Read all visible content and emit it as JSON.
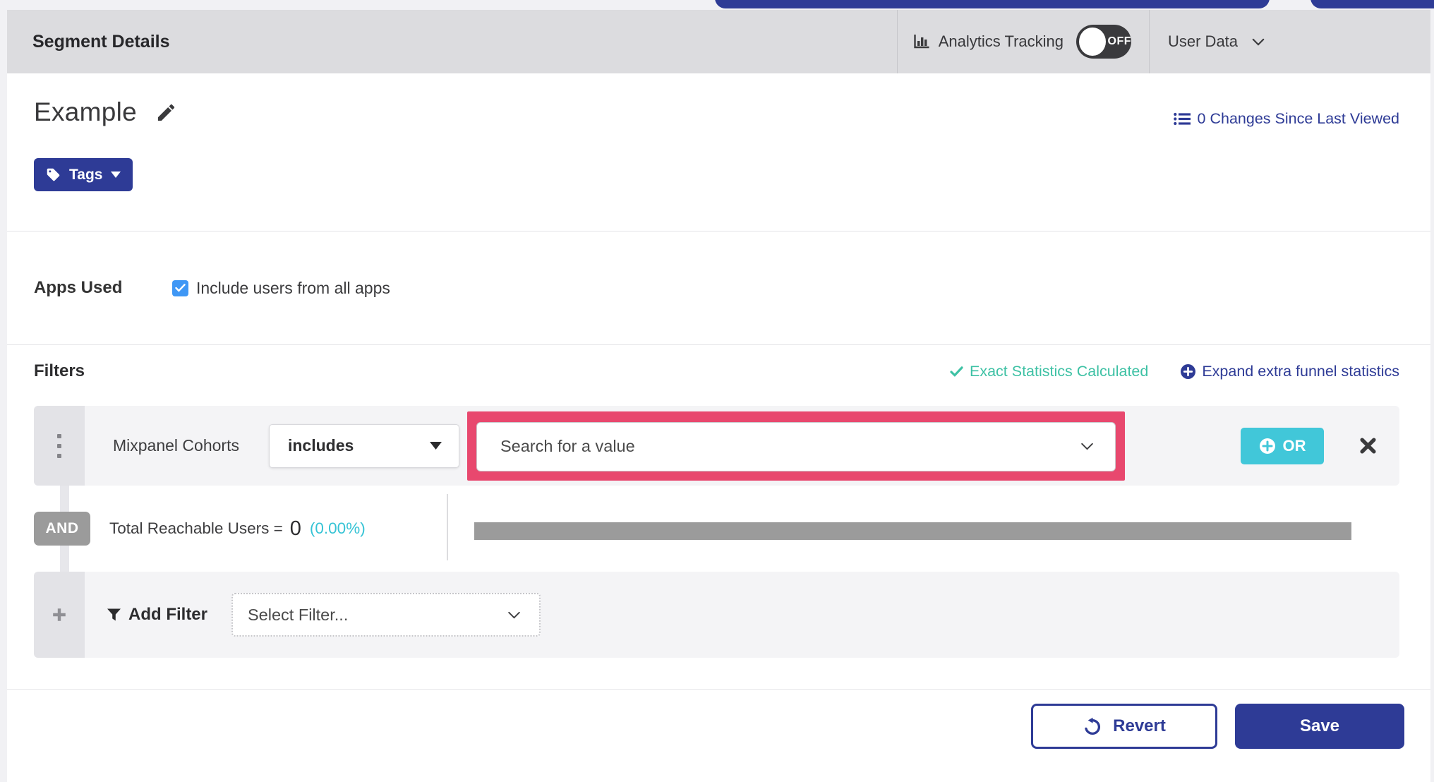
{
  "header": {
    "title": "Segment Details",
    "analytics_tracking": {
      "label": "Analytics Tracking",
      "toggle_state": "OFF"
    },
    "user_data": {
      "label": "User Data"
    }
  },
  "segment": {
    "name": "Example",
    "tags_button": "Tags",
    "changes_link": "0 Changes Since Last Viewed"
  },
  "apps_used": {
    "label": "Apps Used",
    "include_all_label": "Include users from all apps",
    "include_all_checked": true
  },
  "filters": {
    "heading": "Filters",
    "exact_statistics": "Exact Statistics Calculated",
    "expand_link": "Expand extra funnel statistics",
    "row": {
      "name": "Mixpanel Cohorts",
      "operator": "includes",
      "value_placeholder": "Search for a value",
      "or_button": "OR"
    },
    "conjunction": "AND",
    "reachable": {
      "label": "Total Reachable Users =",
      "value": "0",
      "percent": "(0.00%)",
      "progress_percent": 0
    },
    "add_filter": {
      "label": "Add Filter",
      "placeholder": "Select Filter..."
    }
  },
  "footer": {
    "revert": "Revert",
    "save": "Save"
  },
  "icons": {
    "bar-chart-icon": "bar chart glyph",
    "toggle-switch": "off switch",
    "chevron-down-icon": "⌄",
    "pencil-icon": "edit pencil",
    "changes-list-icon": "bulleted list",
    "tag-icon": "label tag",
    "caret-down-icon": "▾",
    "check-icon": "✔",
    "plus-circle-icon": "⨁",
    "drag-handle-icon": "vertical dots",
    "close-icon": "✖",
    "funnel-icon": "filter funnel",
    "plus-icon": "✚",
    "undo-icon": "↺"
  },
  "colors": {
    "indigo": "#2e3b96",
    "teal_or_button": "#41c7d9",
    "green_check": "#3dc1a4",
    "cyan_percent": "#35c3d5",
    "pink_highlight": "#e8486e",
    "checkbox_blue": "#3f97f5",
    "badge_gray": "#9b9b9b",
    "titlebar_gray": "#dcdcdf"
  }
}
